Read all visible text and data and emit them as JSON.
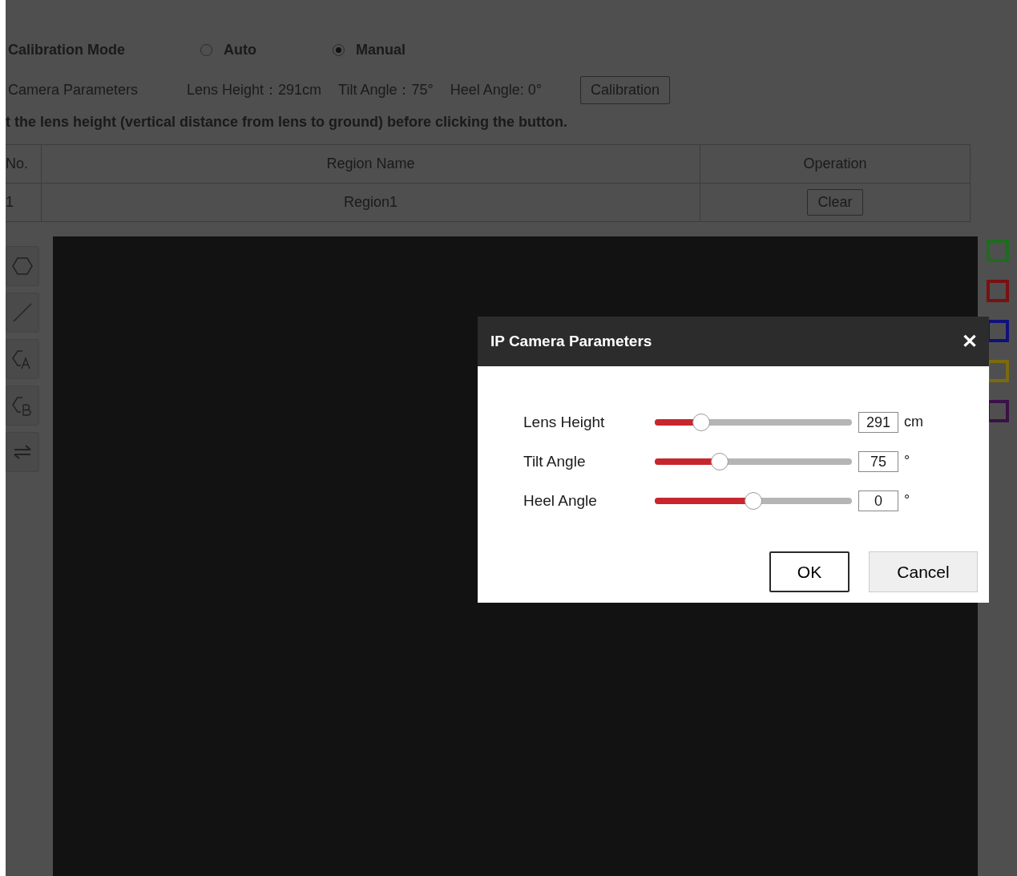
{
  "calibration_mode": {
    "label": "Calibration Mode",
    "options": [
      {
        "label": "Auto",
        "selected": false
      },
      {
        "label": "Manual",
        "selected": true
      }
    ]
  },
  "camera_parameters": {
    "label": "Camera Parameters",
    "lens_height": "Lens Height：291cm",
    "tilt_angle": "Tilt Angle：75°",
    "heel_angle": "Heel Angle: 0°",
    "button": "Calibration"
  },
  "hint": "t the lens height (vertical distance from lens to ground) before clicking the button.",
  "table": {
    "columns": [
      "No.",
      "Region Name",
      "Operation"
    ],
    "rows": [
      {
        "no": "1",
        "name": "Region1",
        "button": "Clear"
      }
    ]
  },
  "tools": [
    {
      "kind": "polygon"
    },
    {
      "kind": "line"
    },
    {
      "kind": "polygon-a"
    },
    {
      "kind": "polygon-b"
    },
    {
      "kind": "swap"
    }
  ],
  "color_swatches": [
    {
      "color": "#1f6b1f"
    },
    {
      "color": "#7a1010"
    },
    {
      "color": "#10107a"
    },
    {
      "color": "#7a6a10"
    },
    {
      "color": "#3a1048"
    }
  ],
  "dialog": {
    "title": "IP Camera Parameters",
    "close": "✕",
    "params": [
      {
        "label": "Lens Height",
        "level": 0.235,
        "value": "291",
        "unit": "cm"
      },
      {
        "label": "Tilt Angle",
        "level": 0.33,
        "value": "75",
        "unit": "°"
      },
      {
        "label": "Heel Angle",
        "level": 0.5,
        "value": "0",
        "unit": "°"
      }
    ],
    "ok": "OK",
    "cancel": "Cancel"
  }
}
